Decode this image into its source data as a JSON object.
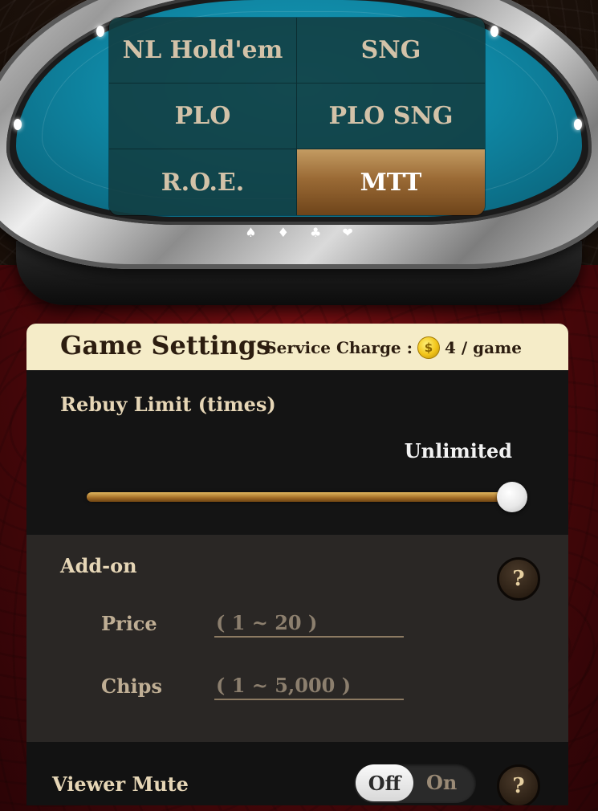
{
  "game_types": [
    {
      "label": "NL Hold'em"
    },
    {
      "label": "SNG"
    },
    {
      "label": "PLO"
    },
    {
      "label": "PLO SNG"
    },
    {
      "label": "R.O.E."
    },
    {
      "label": "MTT"
    }
  ],
  "selected_game_type": "MTT",
  "suits": [
    "♠",
    "♦",
    "♣",
    "❤"
  ],
  "settings": {
    "title": "Game Settings",
    "service_charge_label": "Service Charge :",
    "coin_symbol": "$",
    "service_charge_value": "4 / game"
  },
  "rebuy": {
    "label": "Rebuy Limit (times)",
    "value": "Unlimited",
    "slider_fraction": 1.0
  },
  "addon": {
    "label": "Add-on",
    "help": "?",
    "price_label": "Price",
    "price_placeholder": "( 1 ~ 20 )",
    "chips_label": "Chips",
    "chips_placeholder": "( 1 ~ 5,000 )"
  },
  "viewer_mute": {
    "label": "Viewer Mute",
    "off_label": "Off",
    "on_label": "On",
    "state": "Off",
    "help": "?"
  },
  "colors": {
    "felt_teal": "#0f86a3",
    "active_gold": "#9a6a35",
    "header_cream": "#f5ecc8"
  }
}
